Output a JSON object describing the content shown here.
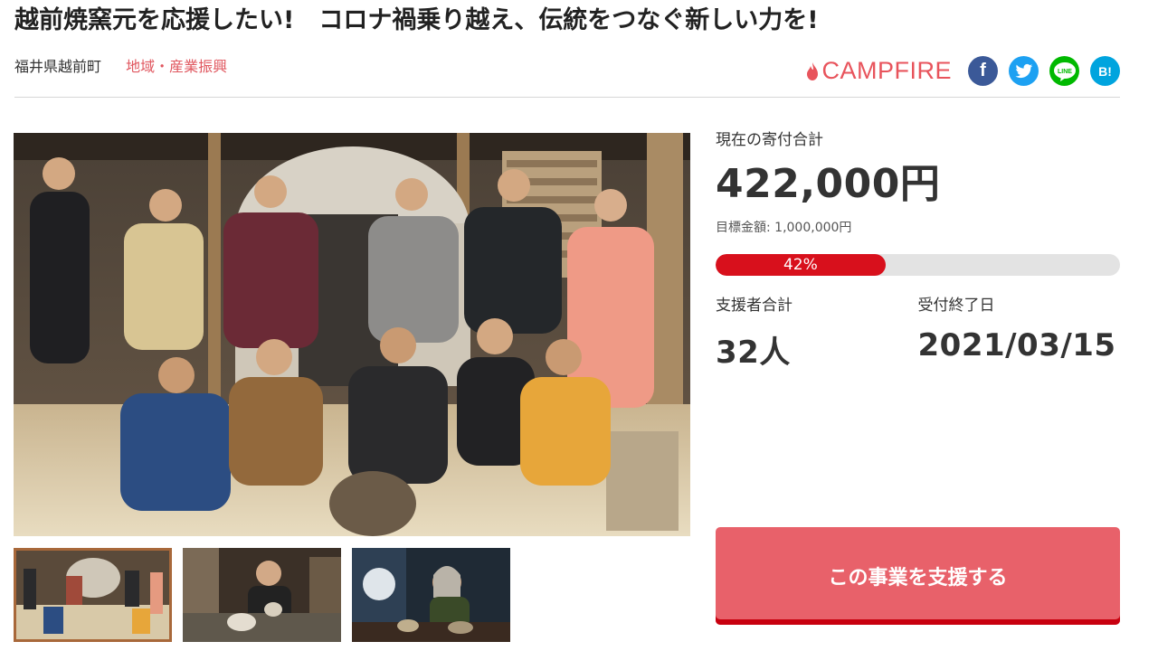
{
  "project": {
    "title": "越前焼窯元を応援したい!　コロナ禍乗り越え、伝統をつなぐ新しい力を!",
    "location": "福井県越前町",
    "category": "地域・産業振興"
  },
  "share": {
    "brand": "CAMPFIRE",
    "facebook": "f",
    "line": "LINE",
    "hatena": "B!"
  },
  "stats": {
    "raised_label": "現在の寄付合計",
    "raised_amount": "422,000円",
    "goal_text": "目標金額: 1,000,000円",
    "progress_percent": 42,
    "progress_label": "42%",
    "supporters_label": "支援者合計",
    "supporters_value": "32人",
    "deadline_label": "受付終了日",
    "deadline_value": "2021/03/15"
  },
  "cta": {
    "label": "この事業を支援する"
  },
  "colors": {
    "accent": "#e8616a",
    "progress": "#d8101c",
    "category": "#e0575f"
  }
}
